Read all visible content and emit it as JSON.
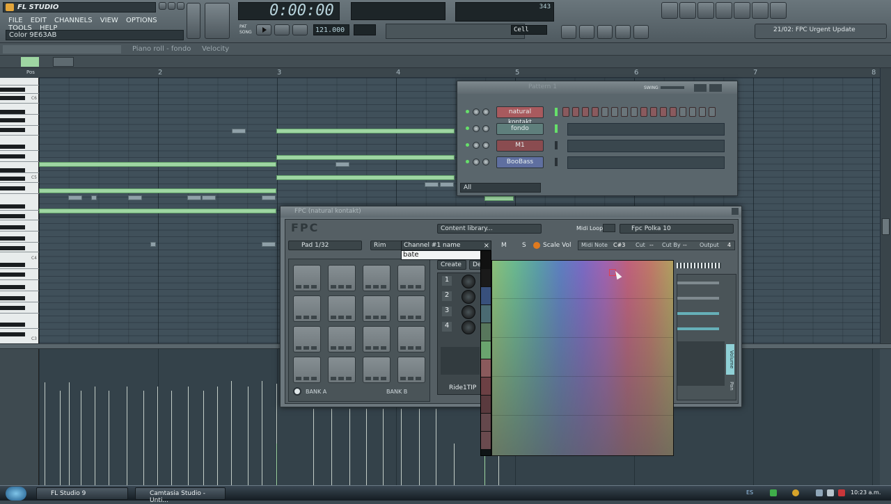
{
  "app": {
    "title": "FL STUDIO",
    "hint": "Color 9E63AB"
  },
  "menu": [
    "FILE",
    "EDIT",
    "CHANNELS",
    "VIEW",
    "OPTIONS",
    "TOOLS",
    "HELP"
  ],
  "transport": {
    "time": "0:00:00",
    "tempo": "121.000",
    "pattern": "PAT",
    "song": "SONG",
    "cpu": "343",
    "snap": "Cell"
  },
  "news": "21/02: FPC Urgent Update",
  "pianoroll": {
    "title": "Piano roll - fondo",
    "event": "Velocity",
    "pos_label": "Pos",
    "bars": [
      "2",
      "3",
      "4",
      "5",
      "6",
      "7",
      "8"
    ],
    "key_labels": [
      "C6",
      "C5",
      "C4",
      "C3"
    ]
  },
  "pattern_window": {
    "title": "Pattern 1",
    "swing": "SWING",
    "filter": "All",
    "channels": [
      {
        "name": "natural kontakt",
        "color": "#a85a5e"
      },
      {
        "name": "fondo",
        "color": "#5f7f7c"
      },
      {
        "name": "M1",
        "color": "#8a4c50"
      },
      {
        "name": "BooBass",
        "color": "#5f6fa0"
      }
    ]
  },
  "fpc": {
    "title": "FPC (natural kontakt)",
    "logo": "FPC",
    "library": "Content library...",
    "midi_loop": "Midi Loop",
    "loop_name": "Fpc Polka 10",
    "pad_label": "Pad 1/32",
    "rim": "Rim",
    "m": "M",
    "s": "S",
    "scale_vol": "Scale Vol",
    "midi_note_label": "Midi Note",
    "midi_note": "C#3",
    "cut_label": "Cut",
    "cut": "--",
    "cutby_label": "Cut By",
    "cutby": "--",
    "output_label": "Output",
    "output": "4",
    "create": "Create",
    "de": "De",
    "layers": [
      "1",
      "2",
      "3",
      "4"
    ],
    "sample": "Ride1TIP",
    "bank_a": "BANK A",
    "bank_b": "BANK B",
    "volume": "Volume",
    "pan": "Pan"
  },
  "picker": {
    "header": "Channel #1 name",
    "value": "bate",
    "strip_colors": [
      "#111111",
      "#1a1a1a",
      "#38507c",
      "#4a6a72",
      "#58775c",
      "#6aa46e",
      "#8a5a5c",
      "#6c4044",
      "#5a3a3e",
      "#64484c",
      "#6a4a4e"
    ]
  },
  "taskbar": {
    "items": [
      "FL Studio 9",
      "Camtasia Studio - Unti..."
    ],
    "lang": "ES",
    "clock": "10:23 a.m."
  }
}
